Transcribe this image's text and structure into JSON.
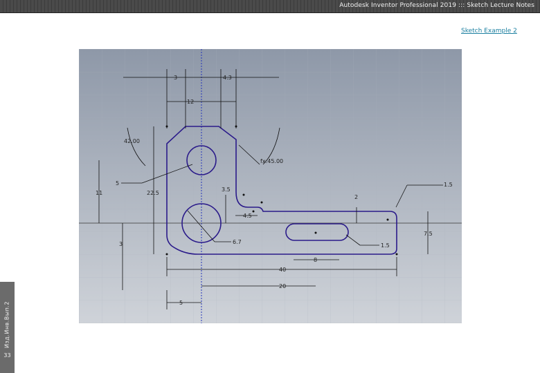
{
  "header": {
    "title": "Autodesk Inventor Professional 2019 ::: Sketch Lecture Notes"
  },
  "link": {
    "label": "Sketch Example 2"
  },
  "side_tab": {
    "vertical_text": "Изд.Инв.Вып.2",
    "page_number": "33"
  },
  "sketch": {
    "dimensions": {
      "d3": "3",
      "d4_3": "4.3",
      "d12": "12",
      "d42": "42.00",
      "d5_left": "5",
      "dfx45": "fx:45.00",
      "d11": "11",
      "d22_5": "22.5",
      "d3_5": "3.5",
      "d4_5": "4.5",
      "d2": "2",
      "d1_5_top": "1.5",
      "d7_5": "7.5",
      "d1_5_slot": "1.5",
      "d6_7": "6.7",
      "d8": "8",
      "d40": "40",
      "d20": "20",
      "d5_bottom": "5",
      "d3_bottom": "3"
    }
  }
}
